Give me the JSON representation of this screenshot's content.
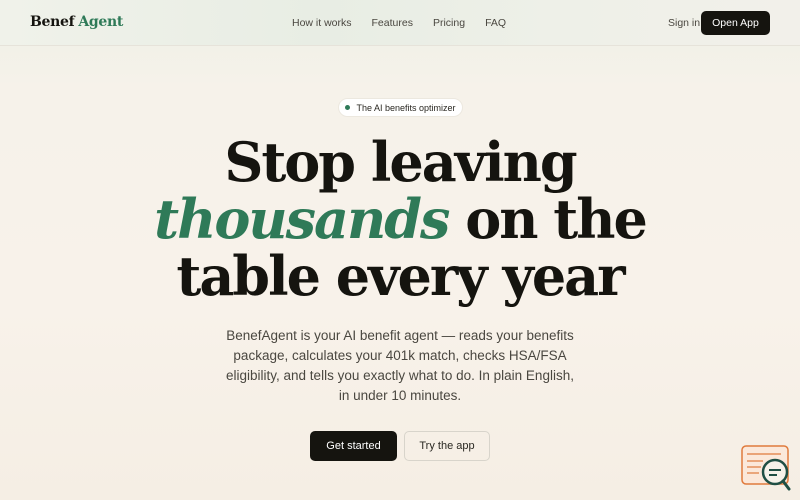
{
  "header": {
    "logo_part1": "Benef",
    "logo_part2": "Agent",
    "nav": [
      "How it works",
      "Features",
      "Pricing",
      "FAQ"
    ],
    "signin_label": "Sign in",
    "open_app_label": "Open App"
  },
  "hero": {
    "badge_text": "The AI benefits optimizer",
    "headline_line1": "Stop leaving",
    "headline_emphasis": "thousands",
    "headline_line2_rest": " on the",
    "headline_line3": "table every year",
    "subtitle": "BenefAgent is your AI benefit agent — reads your benefits package, calculates your 401k match, checks HSA/FSA eligibility, and tells you exactly what to do. In plain English, in under 10 minutes.",
    "primary_cta": "Get started",
    "secondary_cta": "Try the app"
  },
  "colors": {
    "accent": "#2f7a58",
    "ink": "#15140f",
    "background": "#f8f2ea"
  },
  "icons": {
    "widget": "chat-search-icon"
  }
}
